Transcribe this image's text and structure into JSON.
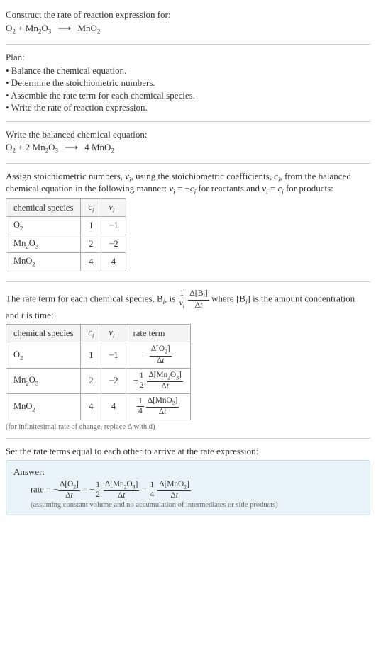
{
  "header": {
    "prompt": "Construct the rate of reaction expression for:",
    "unbalanced": "O₂ + Mn₂O₃ ⟶ MnO₂"
  },
  "plan": {
    "title": "Plan:",
    "items": [
      "• Balance the chemical equation.",
      "• Determine the stoichiometric numbers.",
      "• Assemble the rate term for each chemical species.",
      "• Write the rate of reaction expression."
    ]
  },
  "balanced": {
    "title": "Write the balanced chemical equation:",
    "equation": "O₂ + 2 Mn₂O₃ ⟶ 4 MnO₂"
  },
  "stoich": {
    "intro_a": "Assign stoichiometric numbers, νᵢ, using the stoichiometric coefficients, cᵢ, from the balanced chemical equation in the following manner: νᵢ = −cᵢ for reactants and νᵢ = cᵢ for products:",
    "headers": [
      "chemical species",
      "cᵢ",
      "νᵢ"
    ],
    "rows": [
      {
        "sp": "O₂",
        "c": "1",
        "v": "−1"
      },
      {
        "sp": "Mn₂O₃",
        "c": "2",
        "v": "−2"
      },
      {
        "sp": "MnO₂",
        "c": "4",
        "v": "4"
      }
    ]
  },
  "rate_term": {
    "intro_pre": "The rate term for each chemical species, Bᵢ, is ",
    "intro_post": " where [Bᵢ] is the amount concentration and t is time:",
    "headers": [
      "chemical species",
      "cᵢ",
      "νᵢ",
      "rate term"
    ],
    "rows": [
      {
        "sp": "O₂",
        "c": "1",
        "v": "−1"
      },
      {
        "sp": "Mn₂O₃",
        "c": "2",
        "v": "−2"
      },
      {
        "sp": "MnO₂",
        "c": "4",
        "v": "4"
      }
    ],
    "note": "(for infinitesimal rate of change, replace Δ with d)"
  },
  "final": {
    "title": "Set the rate terms equal to each other to arrive at the rate expression:",
    "answer_label": "Answer:",
    "assumption": "(assuming constant volume and no accumulation of intermediates or side products)"
  },
  "chart_data": {
    "type": "table",
    "reaction_unbalanced": {
      "reactants": [
        "O2",
        "Mn2O3"
      ],
      "products": [
        "MnO2"
      ]
    },
    "reaction_balanced": {
      "reactants": [
        {
          "species": "O2",
          "coeff": 1
        },
        {
          "species": "Mn2O3",
          "coeff": 2
        }
      ],
      "products": [
        {
          "species": "MnO2",
          "coeff": 4
        }
      ]
    },
    "stoichiometric_table": [
      {
        "species": "O2",
        "c_i": 1,
        "nu_i": -1
      },
      {
        "species": "Mn2O3",
        "c_i": 2,
        "nu_i": -2
      },
      {
        "species": "MnO2",
        "c_i": 4,
        "nu_i": 4
      }
    ],
    "rate_expression": "rate = -Δ[O2]/Δt = -(1/2) Δ[Mn2O3]/Δt = (1/4) Δ[MnO2]/Δt"
  }
}
